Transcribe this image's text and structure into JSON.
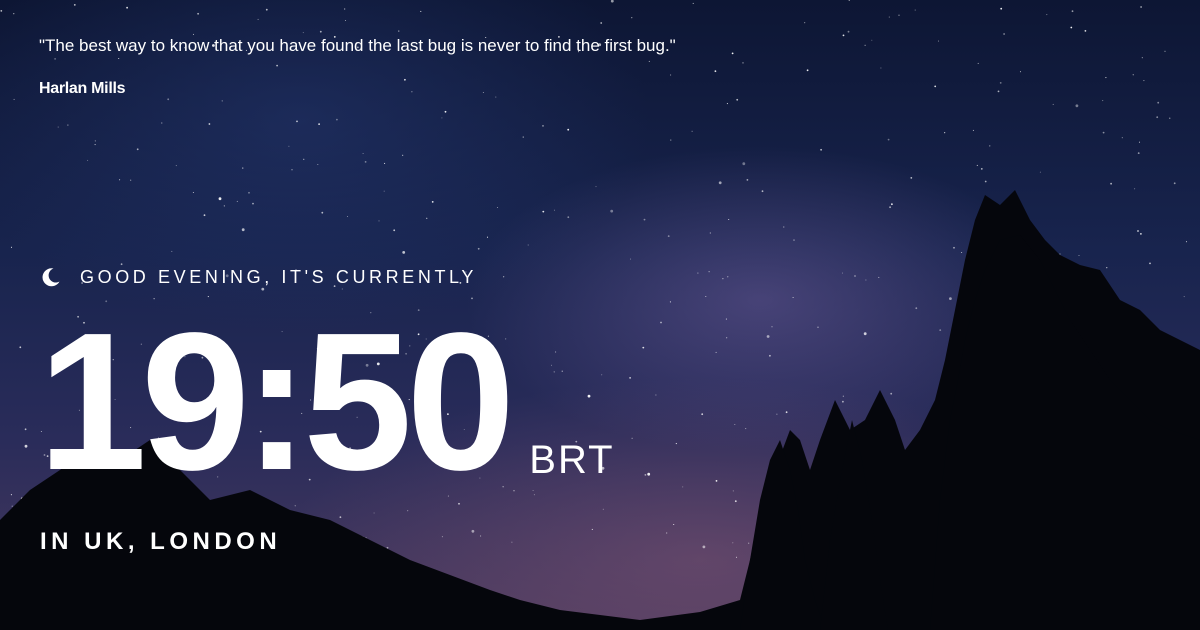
{
  "quote": {
    "text": "\"The best way to know that you have found the last bug is never to find the first bug.\"",
    "author": "Harlan Mills"
  },
  "greeting": {
    "icon": "moon-icon",
    "text": "GOOD EVENING, IT'S CURRENTLY"
  },
  "clock": {
    "time": "19:50",
    "timezone": "BRT"
  },
  "location": {
    "text": "IN UK, LONDON"
  },
  "colors": {
    "text": "#ffffff",
    "sky_top": "#0d1634",
    "sky_bottom": "#4a3a5e",
    "trees": "#05060c"
  }
}
